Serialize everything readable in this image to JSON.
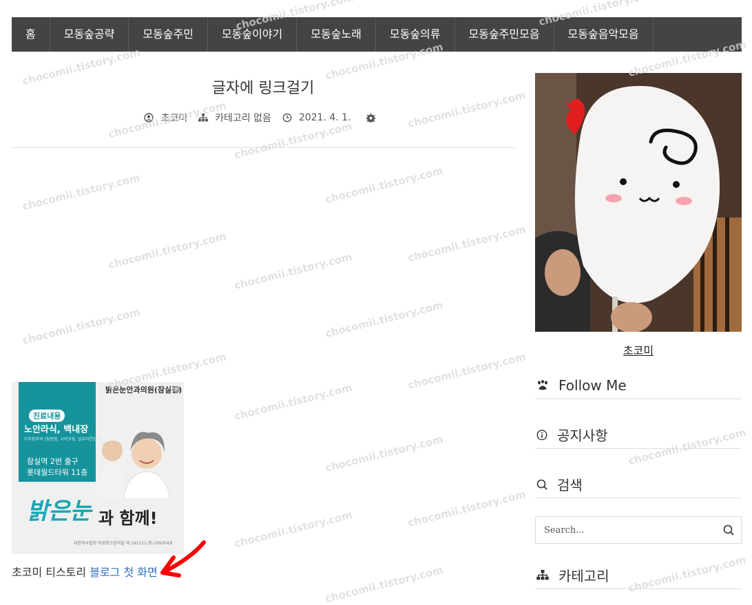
{
  "nav": {
    "items": [
      {
        "label": "홈"
      },
      {
        "label": "모동숲공략"
      },
      {
        "label": "모동숲주민"
      },
      {
        "label": "모동숲이야기"
      },
      {
        "label": "모동숲노래"
      },
      {
        "label": "모동숲의류"
      },
      {
        "label": "모동숲주민모음"
      },
      {
        "label": "모동숲음악모음"
      }
    ]
  },
  "post": {
    "title": "글자에 링크걸기",
    "meta": {
      "author": "초코미",
      "category": "카테고리 없음",
      "date": "2021. 4. 1."
    },
    "body_prefix": "초코미 티스토리 ",
    "body_link": "블로그 첫 화면"
  },
  "ad": {
    "brand": "밝은눈안과의원(잠실점)",
    "tag": "진료내용",
    "headline": "노안라식, 백내장",
    "small": "부작용주의 (빛번짐, 시야흐림, 일부자연감소)",
    "location1": "잠실역 2번 출구",
    "location2": "롯데월드타워 11층",
    "slogan_script": "밝은눈",
    "slogan_text": "과 함께!",
    "fine_print": "대한의사협회 의료광고심의필 제 191211-중-109304호"
  },
  "sidebar": {
    "profile_name": "초코미",
    "follow_title": "Follow Me",
    "notice_title": "공지사항",
    "search_title": "검색",
    "search_placeholder": "Search...",
    "category_title": "카테고리"
  },
  "watermark_text": "chocomii.tistory.com",
  "colors": {
    "nav_bg": "#444444",
    "link": "#2f6ebd",
    "ad_teal": "#17939c"
  }
}
